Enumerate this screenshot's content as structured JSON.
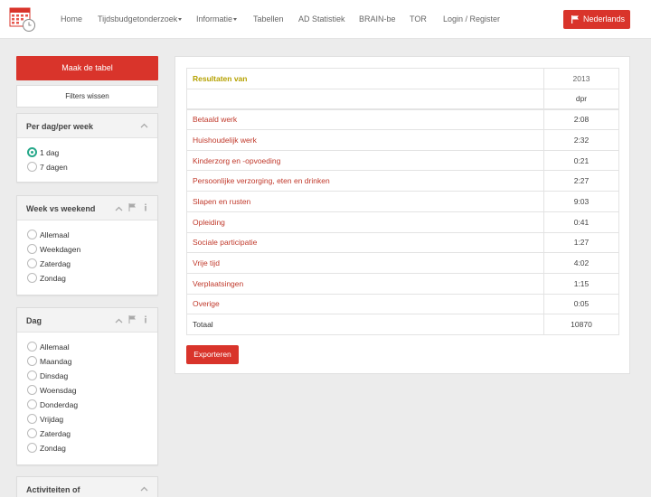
{
  "nav": {
    "items": [
      {
        "label": "Home"
      },
      {
        "label": "Tijdsbudgetonderzoek",
        "dropdown": true
      },
      {
        "label": "Informatie",
        "dropdown": true
      },
      {
        "label": "Tabellen"
      },
      {
        "label": "AD Statistiek"
      },
      {
        "label": "BRAIN-be"
      },
      {
        "label": "TOR"
      },
      {
        "label": "Login / Register"
      }
    ],
    "language_label": "Nederlands",
    "brand_color": "#d9342b"
  },
  "sidebar": {
    "make_table_label": "Maak de tabel",
    "clear_filters_label": "Filters wissen",
    "panels": [
      {
        "title": "Per dag/per week",
        "options": [
          {
            "label": "1 dag",
            "selected": true
          },
          {
            "label": "7 dagen",
            "selected": false
          }
        ]
      },
      {
        "title": "Week vs weekend",
        "options": [
          {
            "label": "Allemaal",
            "selected": false
          },
          {
            "label": "Weekdagen",
            "selected": false
          },
          {
            "label": "Zaterdag",
            "selected": false
          },
          {
            "label": "Zondag",
            "selected": false
          }
        ]
      },
      {
        "title": "Dag",
        "options": [
          {
            "label": "Allemaal",
            "selected": false
          },
          {
            "label": "Maandag",
            "selected": false
          },
          {
            "label": "Dinsdag",
            "selected": false
          },
          {
            "label": "Woensdag",
            "selected": false
          },
          {
            "label": "Donderdag",
            "selected": false
          },
          {
            "label": "Vrijdag",
            "selected": false
          },
          {
            "label": "Zaterdag",
            "selected": false
          },
          {
            "label": "Zondag",
            "selected": false
          }
        ]
      },
      {
        "title": "Activiteiten of"
      }
    ]
  },
  "results": {
    "header_label": "Resultaten van",
    "year": "2013",
    "unit": "dpr",
    "rows": [
      {
        "label": "Betaald werk",
        "value": "2:08"
      },
      {
        "label": "Huishoudelijk werk",
        "value": "2:32"
      },
      {
        "label": "Kinderzorg en -opvoeding",
        "value": "0:21"
      },
      {
        "label": "Persoonlijke verzorging, eten en drinken",
        "value": "2:27"
      },
      {
        "label": "Slapen en rusten",
        "value": "9:03"
      },
      {
        "label": "Opleiding",
        "value": "0:41"
      },
      {
        "label": "Sociale participatie",
        "value": "1:27"
      },
      {
        "label": "Vrije tijd",
        "value": "4:02"
      },
      {
        "label": "Verplaatsingen",
        "value": "1:15"
      },
      {
        "label": "Overige",
        "value": "0:05"
      }
    ],
    "total_label": "Totaal",
    "total_value": "10870",
    "export_label": "Exporteren"
  }
}
